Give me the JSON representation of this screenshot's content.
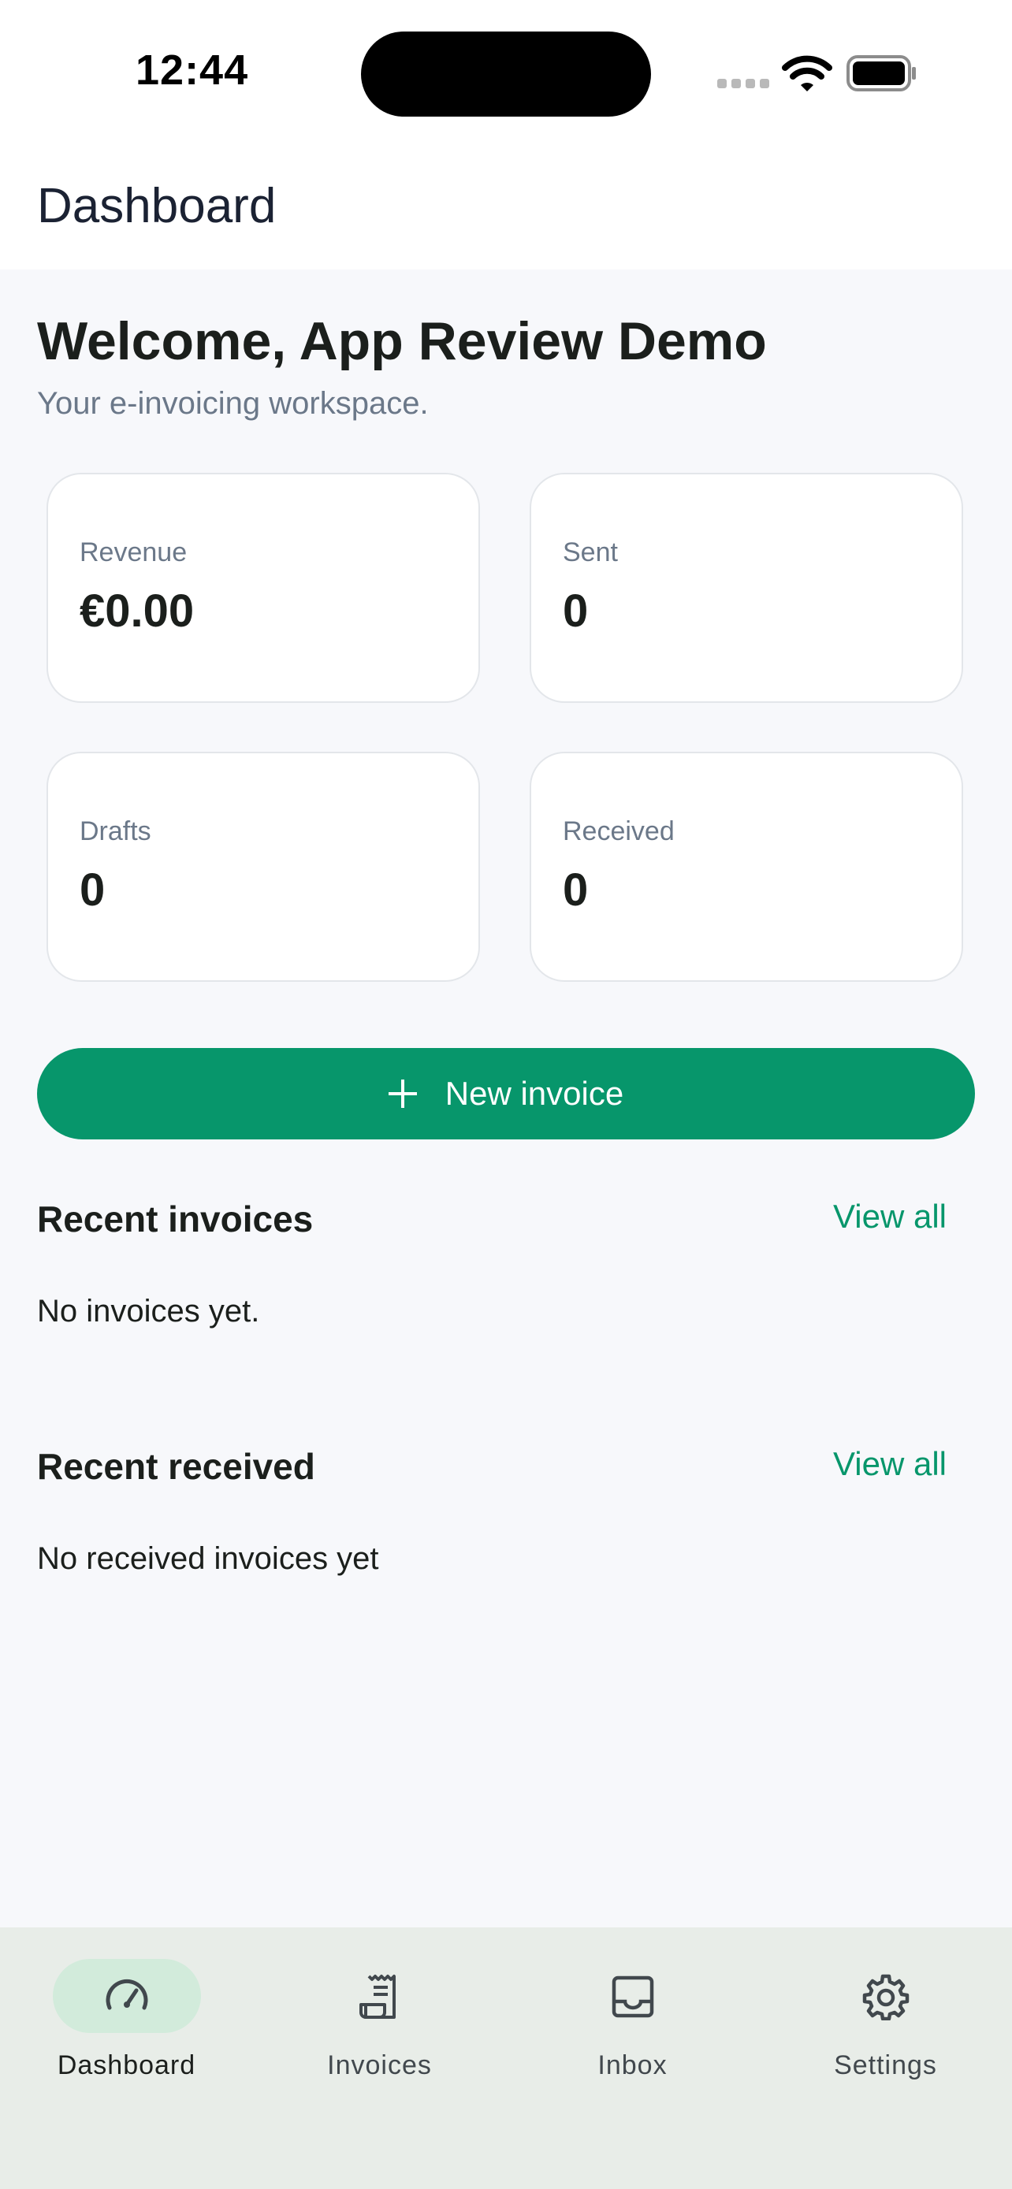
{
  "status_bar": {
    "time": "12:44"
  },
  "header": {
    "title": "Dashboard"
  },
  "welcome": {
    "heading": "Welcome, App Review Demo",
    "subtitle": "Your e-invoicing workspace."
  },
  "stats": [
    {
      "label": "Revenue",
      "value": "€0.00"
    },
    {
      "label": "Sent",
      "value": "0"
    },
    {
      "label": "Drafts",
      "value": "0"
    },
    {
      "label": "Received",
      "value": "0"
    }
  ],
  "new_invoice_button": {
    "label": "New invoice",
    "icon": "plus-icon"
  },
  "recent_invoices": {
    "title": "Recent invoices",
    "view_all": "View all",
    "empty": "No invoices yet."
  },
  "recent_received": {
    "title": "Recent received",
    "view_all": "View all",
    "empty": "No received invoices yet"
  },
  "bottom_nav": {
    "items": [
      {
        "label": "Dashboard",
        "icon": "speedometer-icon",
        "active": true
      },
      {
        "label": "Invoices",
        "icon": "receipt-icon",
        "active": false
      },
      {
        "label": "Inbox",
        "icon": "inbox-icon",
        "active": false
      },
      {
        "label": "Settings",
        "icon": "gear-icon",
        "active": false
      }
    ]
  },
  "colors": {
    "accent": "#07966b",
    "background": "#f7f8fb",
    "nav_background": "#e8ede8",
    "active_pill": "#d2ebdb"
  }
}
